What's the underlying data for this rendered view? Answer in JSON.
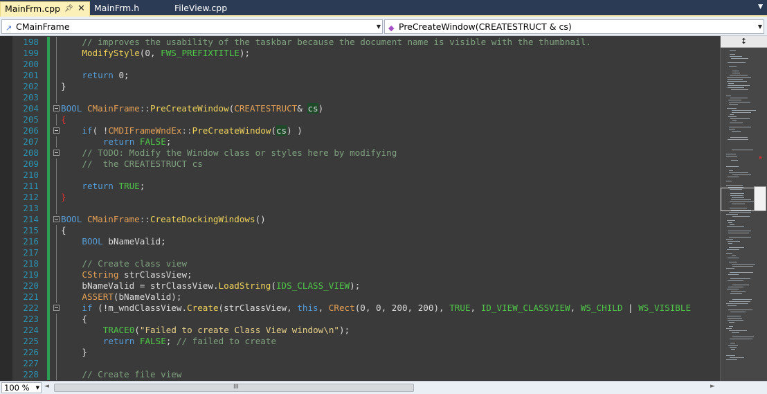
{
  "tabs": [
    {
      "label": "MainFrm.cpp",
      "pin": "•",
      "close": "✕"
    },
    {
      "label": "MainFrm.h"
    },
    {
      "label": "FileView.cpp"
    }
  ],
  "navbar": {
    "class_combo": "CMainFrame",
    "member_combo": "PreCreateWindow(CREATESTRUCT & cs)"
  },
  "editor": {
    "lines": [
      {
        "n": "198",
        "code": [
          [
            "c-cm",
            "// improves the usability of the taskbar because the document name is visible with the thumbnail."
          ]
        ],
        "indent": 4
      },
      {
        "n": "199",
        "code": [
          [
            "c-fn",
            "ModifyStyle"
          ],
          [
            "",
            "(0, "
          ],
          [
            "c-mac",
            "FWS_PREFIXTITLE"
          ],
          [
            "",
            ");"
          ]
        ],
        "indent": 4
      },
      {
        "n": "200",
        "code": [],
        "indent": 0
      },
      {
        "n": "201",
        "code": [
          [
            "c-kw",
            "return"
          ],
          [
            "",
            " 0;"
          ]
        ],
        "indent": 4
      },
      {
        "n": "202",
        "code": [
          [
            "",
            "}"
          ]
        ],
        "indent": 0
      },
      {
        "n": "203",
        "code": [],
        "indent": 0
      },
      {
        "n": "204",
        "code": [
          [
            "c-kw",
            "BOOL"
          ],
          [
            "",
            " "
          ],
          [
            "c-ty",
            "CMainFrame"
          ],
          [
            "c-op",
            "::"
          ],
          [
            "c-fn",
            "PreCreateWindow"
          ],
          [
            "",
            "("
          ],
          [
            "c-ty",
            "CREATESTRUCT"
          ],
          [
            "",
            "& "
          ],
          [
            "hl",
            "cs"
          ],
          [
            "",
            ")"
          ]
        ],
        "indent": 0,
        "fold": true
      },
      {
        "n": "205",
        "code": [
          [
            "c-red",
            "{"
          ]
        ],
        "indent": 0
      },
      {
        "n": "206",
        "code": [
          [
            "c-kw",
            "if"
          ],
          [
            "",
            "( !"
          ],
          [
            "c-ty",
            "CMDIFrameWndEx"
          ],
          [
            "c-op",
            "::"
          ],
          [
            "c-fn",
            "PreCreateWindow"
          ],
          [
            "",
            "("
          ],
          [
            "hl",
            "cs"
          ],
          [
            "",
            ") )"
          ]
        ],
        "indent": 4,
        "fold": true
      },
      {
        "n": "207",
        "code": [
          [
            "c-kw",
            "return"
          ],
          [
            "",
            " "
          ],
          [
            "c-mac",
            "FALSE"
          ],
          [
            "",
            ";"
          ]
        ],
        "indent": 8
      },
      {
        "n": "208",
        "code": [
          [
            "c-cm",
            "// TODO: Modify the Window class or styles here by modifying"
          ]
        ],
        "indent": 4,
        "fold": true
      },
      {
        "n": "209",
        "code": [
          [
            "c-cm",
            "//  the CREATESTRUCT cs"
          ]
        ],
        "indent": 4
      },
      {
        "n": "210",
        "code": [],
        "indent": 0
      },
      {
        "n": "211",
        "code": [
          [
            "c-kw",
            "return"
          ],
          [
            "",
            " "
          ],
          [
            "c-mac",
            "TRUE"
          ],
          [
            "",
            ";"
          ]
        ],
        "indent": 4
      },
      {
        "n": "212",
        "code": [
          [
            "c-red",
            "}"
          ]
        ],
        "indent": 0
      },
      {
        "n": "213",
        "code": [],
        "indent": 0
      },
      {
        "n": "214",
        "code": [
          [
            "c-kw",
            "BOOL"
          ],
          [
            "",
            " "
          ],
          [
            "c-ty",
            "CMainFrame"
          ],
          [
            "c-op",
            "::"
          ],
          [
            "c-fn",
            "CreateDockingWindows"
          ],
          [
            "",
            "()"
          ]
        ],
        "indent": 0,
        "fold": true
      },
      {
        "n": "215",
        "code": [
          [
            "",
            "{"
          ]
        ],
        "indent": 0
      },
      {
        "n": "216",
        "code": [
          [
            "c-kw",
            "BOOL"
          ],
          [
            "",
            " bNameValid;"
          ]
        ],
        "indent": 4
      },
      {
        "n": "217",
        "code": [],
        "indent": 0
      },
      {
        "n": "218",
        "code": [
          [
            "c-cm",
            "// Create class view"
          ]
        ],
        "indent": 4
      },
      {
        "n": "219",
        "code": [
          [
            "c-ty",
            "CString"
          ],
          [
            "",
            " strClassView;"
          ]
        ],
        "indent": 4
      },
      {
        "n": "220",
        "code": [
          [
            "",
            "bNameValid = strClassView."
          ],
          [
            "c-fn",
            "LoadString"
          ],
          [
            "",
            "("
          ],
          [
            "c-mac",
            "IDS_CLASS_VIEW"
          ],
          [
            "",
            ");"
          ]
        ],
        "indent": 4
      },
      {
        "n": "221",
        "code": [
          [
            "c-ty",
            "ASSERT"
          ],
          [
            "",
            "(bNameValid);"
          ]
        ],
        "indent": 4
      },
      {
        "n": "222",
        "code": [
          [
            "c-kw",
            "if"
          ],
          [
            "",
            " (!m_wndClassView."
          ],
          [
            "c-fn",
            "Create"
          ],
          [
            "",
            "(strClassView, "
          ],
          [
            "c-kw",
            "this"
          ],
          [
            "",
            ", "
          ],
          [
            "c-ty",
            "CRect"
          ],
          [
            "",
            "(0, 0, 200, 200), "
          ],
          [
            "c-mac",
            "TRUE"
          ],
          [
            "",
            ", "
          ],
          [
            "c-mac",
            "ID_VIEW_CLASSVIEW"
          ],
          [
            "",
            ", "
          ],
          [
            "c-mac",
            "WS_CHILD"
          ],
          [
            "",
            " | "
          ],
          [
            "c-mac",
            "WS_VISIBLE"
          ]
        ],
        "indent": 4,
        "fold": true
      },
      {
        "n": "223",
        "code": [
          [
            "",
            "{"
          ]
        ],
        "indent": 4
      },
      {
        "n": "224",
        "code": [
          [
            "c-mac",
            "TRACE0"
          ],
          [
            "",
            "("
          ],
          [
            "c-str",
            "\"Failed to create Class View window\\n\""
          ],
          [
            "",
            ");"
          ]
        ],
        "indent": 8
      },
      {
        "n": "225",
        "code": [
          [
            "c-kw",
            "return"
          ],
          [
            "",
            " "
          ],
          [
            "c-mac",
            "FALSE"
          ],
          [
            "",
            "; "
          ],
          [
            "c-cm",
            "// failed to create"
          ]
        ],
        "indent": 8
      },
      {
        "n": "226",
        "code": [
          [
            "",
            "}"
          ]
        ],
        "indent": 4
      },
      {
        "n": "227",
        "code": [],
        "indent": 0
      },
      {
        "n": "228",
        "code": [
          [
            "c-cm",
            "// Create file view"
          ]
        ],
        "indent": 4
      }
    ]
  },
  "overview": {
    "split_glyph": "↕"
  },
  "bottombar": {
    "zoom": "100 %",
    "scroll_grip": "III",
    "left_arrow": "◄",
    "right_arrow": "►"
  }
}
